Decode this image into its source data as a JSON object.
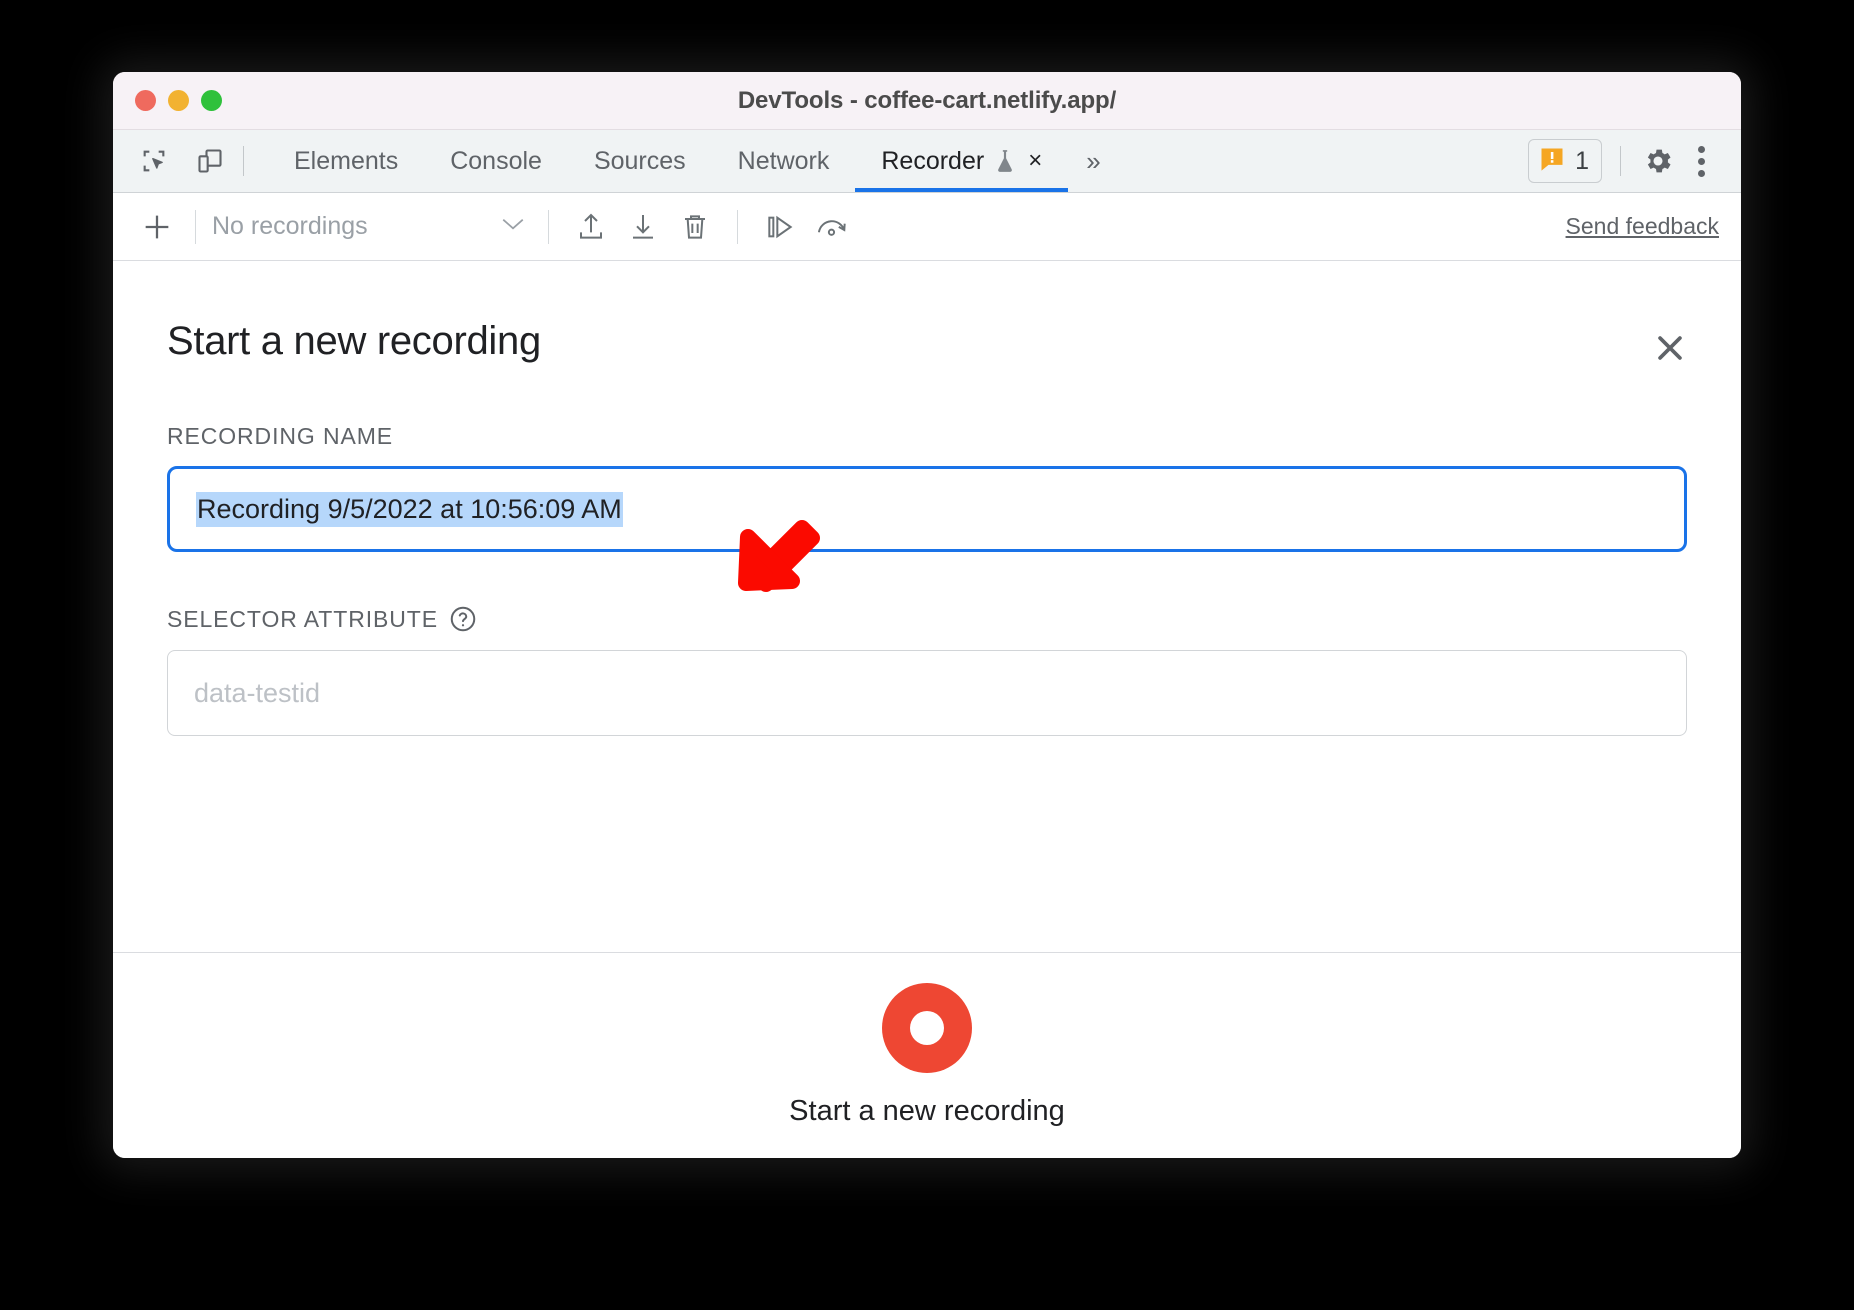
{
  "window": {
    "title": "DevTools - coffee-cart.netlify.app/",
    "traffic_lights": [
      "close",
      "minimize",
      "maximize"
    ]
  },
  "tabbar": {
    "inspect_icon": "inspect-element-icon",
    "device_icon": "device-toolbar-icon",
    "tabs": [
      {
        "label": "Elements",
        "active": false
      },
      {
        "label": "Console",
        "active": false
      },
      {
        "label": "Sources",
        "active": false
      },
      {
        "label": "Network",
        "active": false
      },
      {
        "label": "Recorder",
        "active": true,
        "experimental_icon": "flask-icon",
        "closeable": true
      }
    ],
    "more_tabs_icon": "chevron-double-right-icon",
    "close_tab_glyph": "×",
    "more_glyph": "»",
    "warning_count": "1",
    "warning_icon": "warning-badge-icon",
    "settings_icon": "gear-icon",
    "menu_icon": "kebab-menu-icon",
    "accent_color": "#1a73e8",
    "warning_color": "#f5a623"
  },
  "recorder_toolbar": {
    "add_label": "+",
    "recordings_select_value": "No recordings",
    "caret_glyph": "⌄",
    "icons": [
      {
        "name": "import-icon"
      },
      {
        "name": "export-icon"
      },
      {
        "name": "delete-icon"
      },
      {
        "name": "replay-icon"
      },
      {
        "name": "replay-speed-icon"
      }
    ],
    "send_feedback_label": "Send feedback"
  },
  "panel": {
    "title": "Start a new recording",
    "close_glyph": "✕",
    "recording_name": {
      "label": "RECORDING NAME",
      "value": "Recording 9/5/2022 at 10:56:09 AM",
      "selected": true,
      "focused": true,
      "selection_color": "#b6d7fb"
    },
    "selector_attribute": {
      "label": "SELECTOR ATTRIBUTE",
      "help_icon": "help-circle-icon",
      "value": "",
      "placeholder": "data-testid"
    },
    "footer": {
      "record_button_label": "Start a new recording",
      "record_icon": "record-circle-icon",
      "record_color": "#ee4733"
    }
  },
  "annotation": {
    "arrow": {
      "name": "red-pointer-arrow",
      "color": "#fb0a00",
      "direction": "down-left"
    }
  }
}
